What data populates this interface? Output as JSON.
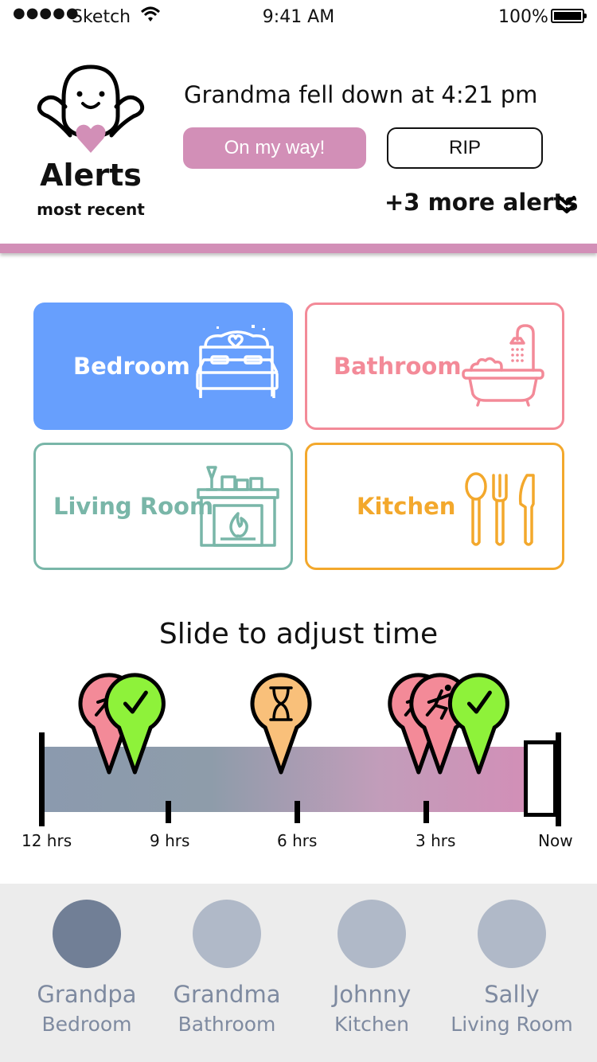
{
  "status_bar": {
    "carrier": "Sketch",
    "time": "9:41 AM",
    "battery": "100%"
  },
  "alerts": {
    "title": "Alerts",
    "subtitle": "most recent",
    "message": "Grandma fell down at 4:21 pm",
    "primary_action": "On my way!",
    "secondary_action": "RIP",
    "more": "+3 more alerts"
  },
  "rooms": [
    {
      "label": "Bedroom",
      "color": "#679ffd"
    },
    {
      "label": "Bathroom",
      "color": "#f38a98"
    },
    {
      "label": "Living Room",
      "color": "#79b6a8"
    },
    {
      "label": "Kitchen",
      "color": "#f3a82c"
    }
  ],
  "timeline": {
    "title": "Slide to adjust time",
    "tick_labels": [
      "12 hrs",
      "9 hrs",
      "6 hrs",
      "3 hrs",
      "Now"
    ],
    "markers": [
      {
        "type": "fall",
        "hours_ago": 10.5,
        "color": "#f38a98"
      },
      {
        "type": "ok",
        "hours_ago": 9.9,
        "color": "#8ef23a"
      },
      {
        "type": "waiting",
        "hours_ago": 6.5,
        "color": "#f9c07a"
      },
      {
        "type": "fall",
        "hours_ago": 3.3,
        "color": "#f38a98"
      },
      {
        "type": "fall",
        "hours_ago": 2.8,
        "color": "#f38a98"
      },
      {
        "type": "ok",
        "hours_ago": 1.9,
        "color": "#8ef23a"
      }
    ]
  },
  "people": [
    {
      "name": "Grandpa",
      "room": "Bedroom",
      "selected": true
    },
    {
      "name": "Grandma",
      "room": "Bathroom",
      "selected": false
    },
    {
      "name": "Johnny",
      "room": "Kitchen",
      "selected": false
    },
    {
      "name": "Sally",
      "room": "Living Room",
      "selected": false
    }
  ],
  "colors": {
    "accent": "#d28fb7",
    "inactive_avatar": "#b0b9c8",
    "active_avatar": "#717f96",
    "people_text": "#7e8aa0"
  }
}
